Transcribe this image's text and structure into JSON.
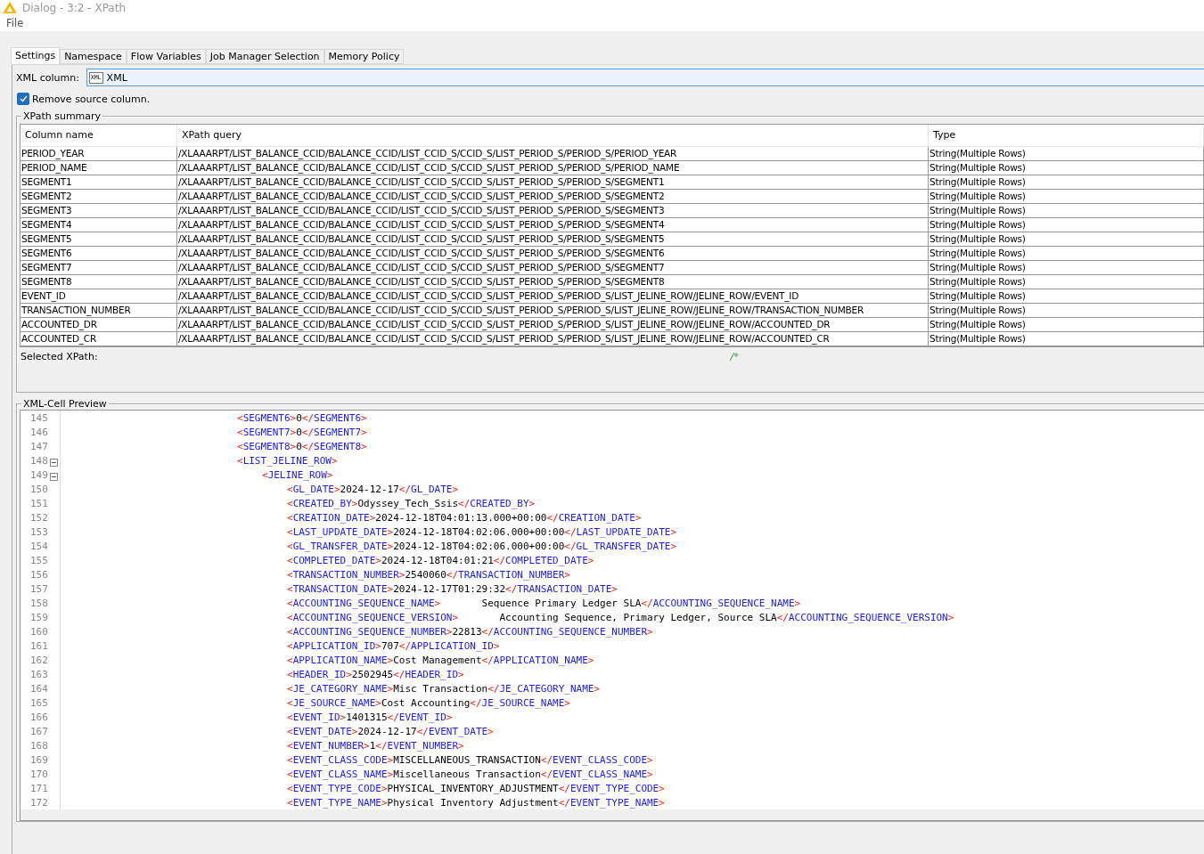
{
  "window": {
    "title": "Dialog - 3:2 - XPath"
  },
  "menu": [
    "File"
  ],
  "tabs": [
    {
      "label": "Settings",
      "selected": true
    },
    {
      "label": "Namespace",
      "selected": false
    },
    {
      "label": "Flow Variables",
      "selected": false
    },
    {
      "label": "Job Manager Selection",
      "selected": false
    },
    {
      "label": "Memory Policy",
      "selected": false
    }
  ],
  "xml_column": {
    "label": "XML column:",
    "type_badge": "XML",
    "value": "XML"
  },
  "remove_source": {
    "label": "Remove source column.",
    "checked": true
  },
  "summary": {
    "title": "XPath summary",
    "columns": [
      "Column name",
      "XPath query",
      "Type"
    ],
    "rows": [
      [
        "PERIOD_YEAR",
        "/XLAAARPT/LIST_BALANCE_CCID/BALANCE_CCID/LIST_CCID_S/CCID_S/LIST_PERIOD_S/PERIOD_S/PERIOD_YEAR",
        "String(Multiple Rows)"
      ],
      [
        "PERIOD_NAME",
        "/XLAAARPT/LIST_BALANCE_CCID/BALANCE_CCID/LIST_CCID_S/CCID_S/LIST_PERIOD_S/PERIOD_S/PERIOD_NAME",
        "String(Multiple Rows)"
      ],
      [
        "SEGMENT1",
        "/XLAAARPT/LIST_BALANCE_CCID/BALANCE_CCID/LIST_CCID_S/CCID_S/LIST_PERIOD_S/PERIOD_S/SEGMENT1",
        "String(Multiple Rows)"
      ],
      [
        "SEGMENT2",
        "/XLAAARPT/LIST_BALANCE_CCID/BALANCE_CCID/LIST_CCID_S/CCID_S/LIST_PERIOD_S/PERIOD_S/SEGMENT2",
        "String(Multiple Rows)"
      ],
      [
        "SEGMENT3",
        "/XLAAARPT/LIST_BALANCE_CCID/BALANCE_CCID/LIST_CCID_S/CCID_S/LIST_PERIOD_S/PERIOD_S/SEGMENT3",
        "String(Multiple Rows)"
      ],
      [
        "SEGMENT4",
        "/XLAAARPT/LIST_BALANCE_CCID/BALANCE_CCID/LIST_CCID_S/CCID_S/LIST_PERIOD_S/PERIOD_S/SEGMENT4",
        "String(Multiple Rows)"
      ],
      [
        "SEGMENT5",
        "/XLAAARPT/LIST_BALANCE_CCID/BALANCE_CCID/LIST_CCID_S/CCID_S/LIST_PERIOD_S/PERIOD_S/SEGMENT5",
        "String(Multiple Rows)"
      ],
      [
        "SEGMENT6",
        "/XLAAARPT/LIST_BALANCE_CCID/BALANCE_CCID/LIST_CCID_S/CCID_S/LIST_PERIOD_S/PERIOD_S/SEGMENT6",
        "String(Multiple Rows)"
      ],
      [
        "SEGMENT7",
        "/XLAAARPT/LIST_BALANCE_CCID/BALANCE_CCID/LIST_CCID_S/CCID_S/LIST_PERIOD_S/PERIOD_S/SEGMENT7",
        "String(Multiple Rows)"
      ],
      [
        "SEGMENT8",
        "/XLAAARPT/LIST_BALANCE_CCID/BALANCE_CCID/LIST_CCID_S/CCID_S/LIST_PERIOD_S/PERIOD_S/SEGMENT8",
        "String(Multiple Rows)"
      ],
      [
        "EVENT_ID",
        "/XLAAARPT/LIST_BALANCE_CCID/BALANCE_CCID/LIST_CCID_S/CCID_S/LIST_PERIOD_S/PERIOD_S/LIST_JELINE_ROW/JELINE_ROW/EVENT_ID",
        "String(Multiple Rows)"
      ],
      [
        "TRANSACTION_NUMBER",
        "/XLAAARPT/LIST_BALANCE_CCID/BALANCE_CCID/LIST_CCID_S/CCID_S/LIST_PERIOD_S/PERIOD_S/LIST_JELINE_ROW/JELINE_ROW/TRANSACTION_NUMBER",
        "String(Multiple Rows)"
      ],
      [
        "ACCOUNTED_DR",
        "/XLAAARPT/LIST_BALANCE_CCID/BALANCE_CCID/LIST_CCID_S/CCID_S/LIST_PERIOD_S/PERIOD_S/LIST_JELINE_ROW/JELINE_ROW/ACCOUNTED_DR",
        "String(Multiple Rows)"
      ],
      [
        "ACCOUNTED_CR",
        "/XLAAARPT/LIST_BALANCE_CCID/BALANCE_CCID/LIST_CCID_S/CCID_S/LIST_PERIOD_S/PERIOD_S/LIST_JELINE_ROW/JELINE_ROW/ACCOUNTED_CR",
        "String(Multiple Rows)"
      ]
    ],
    "selected_label": "Selected XPath:",
    "selected_value": "/*"
  },
  "preview": {
    "title": "XML-Cell Preview",
    "lines": [
      {
        "num": "145",
        "text": "<SEGMENT6>0</SEGMENT6>"
      },
      {
        "num": "146",
        "text": "<SEGMENT7>0</SEGMENT7>"
      },
      {
        "num": "147",
        "text": "<SEGMENT8>0</SEGMENT8>"
      },
      {
        "num": "148",
        "text": "<LIST_JELINE_ROW>",
        "expanded": true,
        "children": [
          {
            "num": "149",
            "text": "<JELINE_ROW>",
            "expanded": true,
            "children": [
              {
                "num": "150",
                "text": "<GL_DATE>2024-12-17</GL_DATE>"
              },
              {
                "num": "151",
                "text": "<CREATED_BY>Odyssey_Tech_Ssis</CREATED_BY>"
              },
              {
                "num": "152",
                "text": "<CREATION_DATE>2024-12-18T04:01:13.000+00:00</CREATION_DATE>"
              },
              {
                "num": "153",
                "text": "<LAST_UPDATE_DATE>2024-12-18T04:02:06.000+00:00</LAST_UPDATE_DATE>"
              },
              {
                "num": "154",
                "text": "<GL_TRANSFER_DATE>2024-12-18T04:02:06.000+00:00</GL_TRANSFER_DATE>"
              },
              {
                "num": "155",
                "text": "<COMPLETED_DATE>2024-12-18T04:01:21</COMPLETED_DATE>"
              },
              {
                "num": "156",
                "text": "<TRANSACTION_NUMBER>2540060</TRANSACTION_NUMBER>"
              },
              {
                "num": "157",
                "text": "<TRANSACTION_DATE>2024-12-17T01:29:32</TRANSACTION_DATE>"
              },
              {
                "num": "158",
                "text": "<ACCOUNTING_SEQUENCE_NAME>       Sequence Primary Ledger SLA</ACCOUNTING_SEQUENCE_NAME>"
              },
              {
                "num": "159",
                "text": "<ACCOUNTING_SEQUENCE_VERSION>       Accounting Sequence, Primary Ledger, Source SLA</ACCOUNTING_SEQUENCE_VERSION>"
              },
              {
                "num": "160",
                "text": "<ACCOUNTING_SEQUENCE_NUMBER>22813</ACCOUNTING_SEQUENCE_NUMBER>"
              },
              {
                "num": "161",
                "text": "<APPLICATION_ID>707</APPLICATION_ID>"
              },
              {
                "num": "162",
                "text": "<APPLICATION_NAME>Cost Management</APPLICATION_NAME>"
              },
              {
                "num": "163",
                "text": "<HEADER_ID>2502945</HEADER_ID>"
              },
              {
                "num": "164",
                "text": "<JE_CATEGORY_NAME>Misc Transaction</JE_CATEGORY_NAME>"
              },
              {
                "num": "165",
                "text": "<JE_SOURCE_NAME>Cost Accounting</JE_SOURCE_NAME>"
              },
              {
                "num": "166",
                "text": "<EVENT_ID>1401315</EVENT_ID>"
              },
              {
                "num": "167",
                "text": "<EVENT_DATE>2024-12-17</EVENT_DATE>"
              },
              {
                "num": "168",
                "text": "<EVENT_NUMBER>1</EVENT_NUMBER>"
              },
              {
                "num": "169",
                "text": "<EVENT_CLASS_CODE>MISCELLANEOUS_TRANSACTION</EVENT_CLASS_CODE>"
              },
              {
                "num": "170",
                "text": "<EVENT_CLASS_NAME>Miscellaneous Transaction</EVENT_CLASS_NAME>"
              },
              {
                "num": "171",
                "text": "<EVENT_TYPE_CODE>PHYSICAL_INVENTORY_ADJUSTMENT</EVENT_TYPE_CODE>"
              },
              {
                "num": "172",
                "text": "<EVENT_TYPE_NAME>Physical Inventory Adjustment</EVENT_TYPE_NAME>"
              }
            ]
          }
        ]
      }
    ]
  }
}
